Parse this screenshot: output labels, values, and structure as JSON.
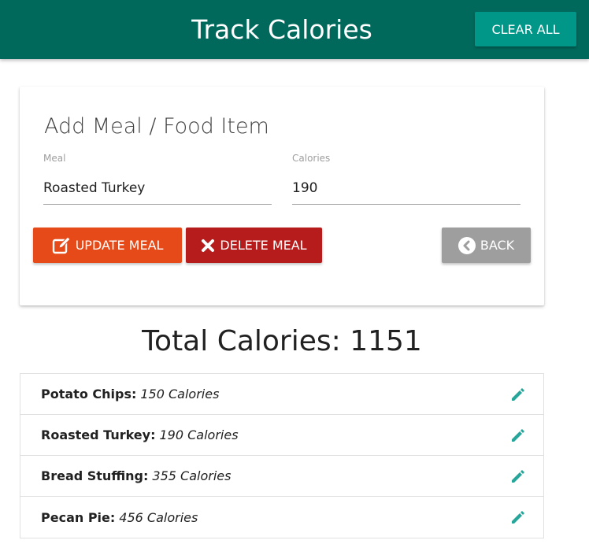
{
  "header": {
    "title": "Track Calories",
    "clear_label": "CLEAR ALL",
    "bg_color": "#00695c",
    "clear_color": "#009688"
  },
  "form": {
    "title": "Add Meal / Food Item",
    "meal_label": "Meal",
    "meal_value": "Roasted Turkey",
    "calories_label": "Calories",
    "calories_value": "190",
    "update_label": "UPDATE MEAL",
    "update_icon": "edit-square-icon",
    "update_color": "#e64a19",
    "delete_label": "DELETE MEAL",
    "delete_icon": "close-icon",
    "delete_color": "#b71c1c",
    "back_label": "BACK",
    "back_icon": "chevron-left-circle-icon",
    "back_color": "#9e9e9e"
  },
  "total": {
    "text": "Total Calories: 1151"
  },
  "items": [
    {
      "name": "Potato Chips:",
      "calories": "150 Calories",
      "icon": "pencil-icon"
    },
    {
      "name": "Roasted Turkey:",
      "calories": "190 Calories",
      "icon": "pencil-icon"
    },
    {
      "name": "Bread Stuffing:",
      "calories": "355 Calories",
      "icon": "pencil-icon"
    },
    {
      "name": "Pecan Pie:",
      "calories": "456 Calories",
      "icon": "pencil-icon"
    }
  ],
  "accent_color": "#26a69a"
}
